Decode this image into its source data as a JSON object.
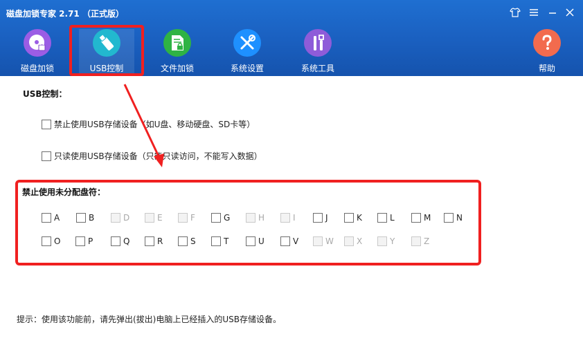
{
  "window": {
    "title": "磁盘加锁专家 2.71 （正式版）"
  },
  "toolbar": {
    "items": [
      {
        "label": "磁盘加锁",
        "icon": "disk-lock-icon",
        "color": "#9b5de5"
      },
      {
        "label": "USB控制",
        "icon": "usb-icon",
        "color": "#22b8cf"
      },
      {
        "label": "文件加锁",
        "icon": "file-lock-icon",
        "color": "#2fb344"
      },
      {
        "label": "系统设置",
        "icon": "wrench-screwdriver-icon",
        "color": "#1e90ff"
      },
      {
        "label": "系统工具",
        "icon": "tools-icon",
        "color": "#8e5cd9"
      },
      {
        "label": "帮助",
        "icon": "help-icon",
        "color": "#f26b4e"
      }
    ],
    "active": "USB控制"
  },
  "usb": {
    "section_title": "USB控制：",
    "opt_block": "禁止使用USB存储设备（如U盘、移动硬盘、SD卡等）",
    "opt_readonly": "只读使用USB存储设备（只能只读访问，不能写入数据）"
  },
  "drives": {
    "section_title": "禁止使用未分配盘符：",
    "row1": [
      {
        "letter": "A",
        "enabled": true
      },
      {
        "letter": "B",
        "enabled": true
      },
      {
        "letter": "D",
        "enabled": false
      },
      {
        "letter": "E",
        "enabled": false
      },
      {
        "letter": "F",
        "enabled": false
      },
      {
        "letter": "G",
        "enabled": true
      },
      {
        "letter": "H",
        "enabled": false
      },
      {
        "letter": "I",
        "enabled": false
      },
      {
        "letter": "J",
        "enabled": true
      },
      {
        "letter": "K",
        "enabled": true
      },
      {
        "letter": "L",
        "enabled": true
      },
      {
        "letter": "M",
        "enabled": true
      },
      {
        "letter": "N",
        "enabled": true
      }
    ],
    "row2": [
      {
        "letter": "O",
        "enabled": true
      },
      {
        "letter": "P",
        "enabled": true
      },
      {
        "letter": "Q",
        "enabled": true
      },
      {
        "letter": "R",
        "enabled": true
      },
      {
        "letter": "S",
        "enabled": true
      },
      {
        "letter": "T",
        "enabled": true
      },
      {
        "letter": "U",
        "enabled": true
      },
      {
        "letter": "V",
        "enabled": true
      },
      {
        "letter": "W",
        "enabled": false
      },
      {
        "letter": "X",
        "enabled": false
      },
      {
        "letter": "Y",
        "enabled": false
      },
      {
        "letter": "Z",
        "enabled": false
      }
    ]
  },
  "hint": "提示：使用该功能前，请先弹出(拔出)电脑上已经插入的USB存储设备。",
  "colors": {
    "header": "#1a5fbf",
    "annotation": "#f02020"
  }
}
